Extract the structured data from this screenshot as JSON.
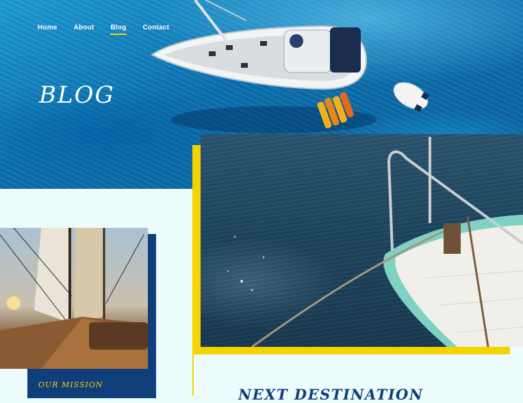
{
  "nav": {
    "items": [
      {
        "label": "Home"
      },
      {
        "label": "About"
      },
      {
        "label": "Blog"
      },
      {
        "label": "Contact"
      }
    ],
    "active": "Blog"
  },
  "hero": {
    "title": "BLOG"
  },
  "mission": {
    "label": "OUR MISSION"
  },
  "destination": {
    "title": "NEXT DESTINATION"
  },
  "colors": {
    "accent": "#f4d300",
    "navy": "#0f3e7a",
    "background": "#ecfbfc",
    "sea": "#0b6fae"
  }
}
